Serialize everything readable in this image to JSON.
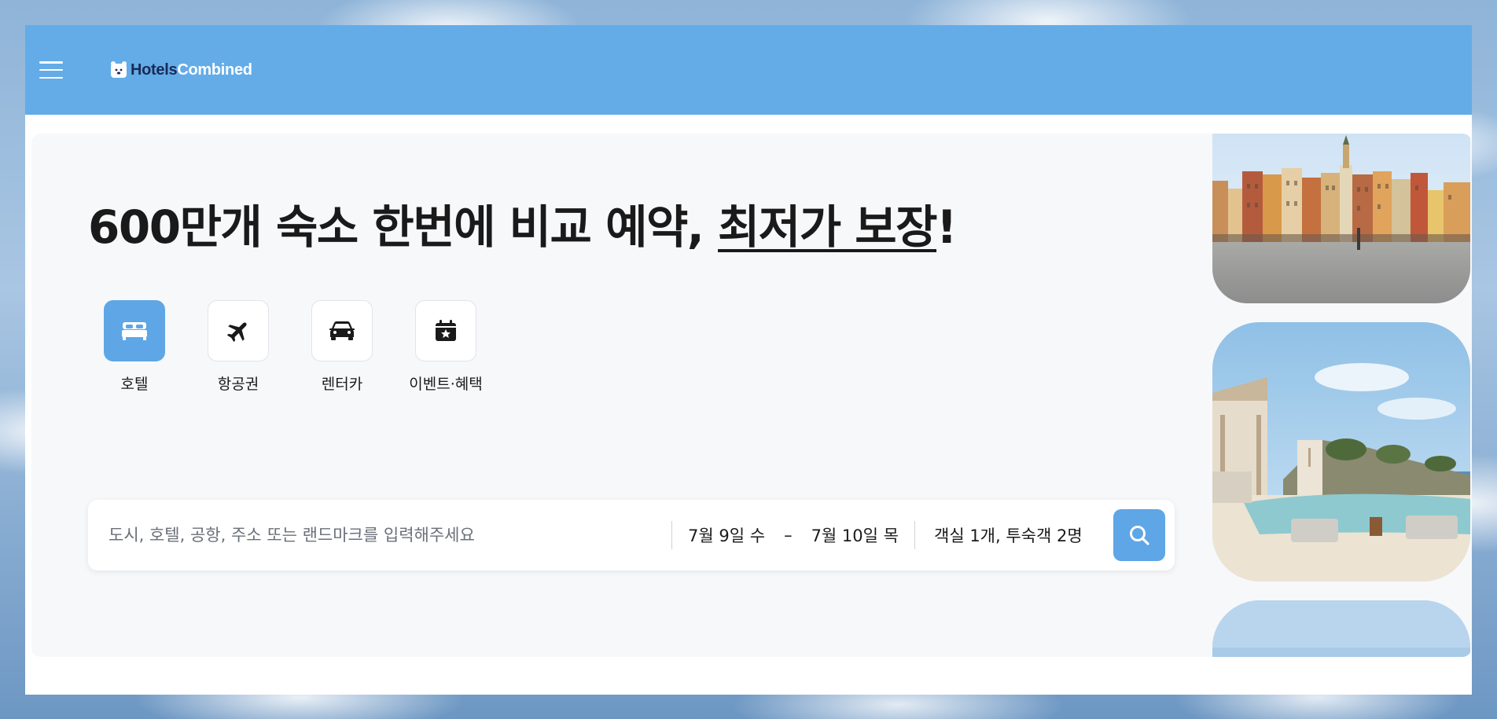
{
  "brand": {
    "name_part1": "Hotels",
    "name_part2": "Combined"
  },
  "headline": {
    "part1": "600만개 숙소 한번에 비교 예약, ",
    "underlined": "최저가 보장",
    "part2": "!"
  },
  "verticals": [
    {
      "label": "호텔",
      "icon": "bed-icon",
      "active": true
    },
    {
      "label": "항공권",
      "icon": "airplane-icon",
      "active": false
    },
    {
      "label": "렌터카",
      "icon": "car-icon",
      "active": false
    },
    {
      "label": "이벤트·혜택",
      "icon": "calendar-star-icon",
      "active": false
    }
  ],
  "search": {
    "placeholder": "도시, 호텔, 공항, 주소 또는 랜드마크를 입력해주세요",
    "value": "",
    "checkin": "7월 9일 수",
    "dash": "–",
    "checkout": "7월 10일 목",
    "guests": "객실 1개, 투숙객 2명",
    "button_icon": "search-icon"
  },
  "colors": {
    "topbar": "#63ace8",
    "accent": "#5ea6e6",
    "brand_dark": "#1a2a55"
  },
  "side_images": [
    {
      "icon": "old-town-square-photo"
    },
    {
      "icon": "resort-pool-photo"
    },
    {
      "icon": "sky-photo"
    }
  ]
}
